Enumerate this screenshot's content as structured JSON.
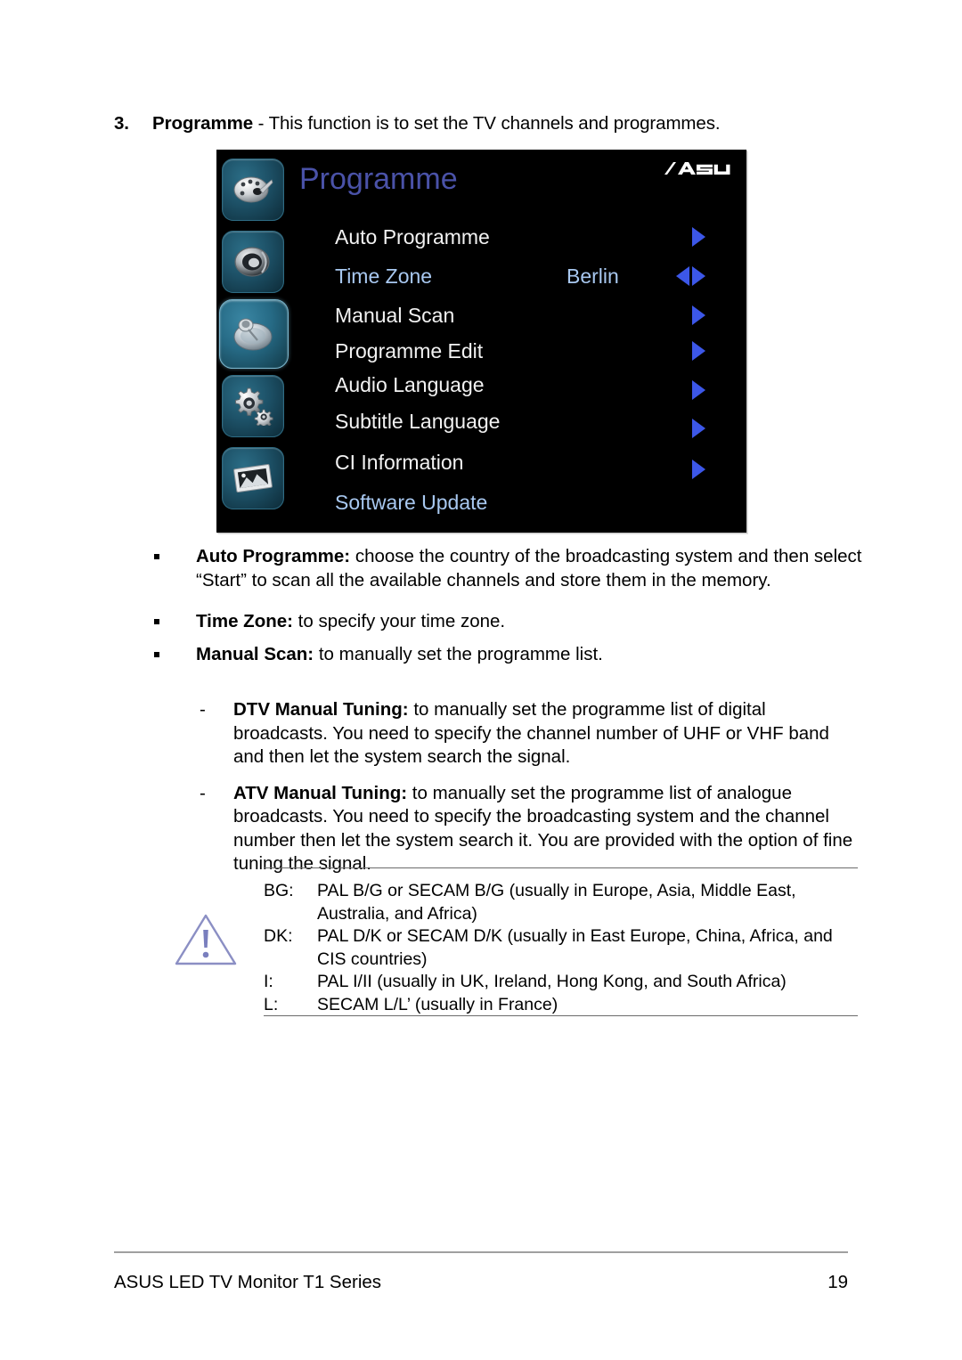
{
  "step": {
    "number": "3.",
    "title": "Programme",
    "description": " - This function is to set the TV channels and programmes."
  },
  "osd": {
    "title": "Programme",
    "brand": "ASUS",
    "sidebar_icons": [
      {
        "name": "palette-icon",
        "label": "Picture"
      },
      {
        "name": "speaker-icon",
        "label": "Sound"
      },
      {
        "name": "satellite-dish-icon",
        "label": "Programme"
      },
      {
        "name": "gears-icon",
        "label": "Setup"
      },
      {
        "name": "photo-icon",
        "label": "Image"
      }
    ],
    "selected_icon_index": 2,
    "colors": {
      "title": "#4a52a8",
      "label": "#f2f2f2",
      "highlight": "#a8c8f0",
      "arrow": "#3c57e8",
      "background": "#000000"
    },
    "rows": [
      {
        "label": "Auto Programme",
        "value": "",
        "arrows": "right",
        "highlighted": false
      },
      {
        "label": "Time Zone",
        "value": "Berlin",
        "arrows": "both",
        "highlighted": true
      },
      {
        "label": "Manual Scan",
        "value": "",
        "arrows": "right",
        "highlighted": false
      },
      {
        "label": "Programme Edit",
        "value": "",
        "arrows": "right",
        "highlighted": false
      },
      {
        "label": "Audio Language",
        "value": "",
        "arrows": "right",
        "highlighted": false
      },
      {
        "label": "Subtitle Language",
        "value": "",
        "arrows": "right",
        "highlighted": false
      },
      {
        "label": "CI Information",
        "value": "",
        "arrows": "right",
        "highlighted": false
      },
      {
        "label": "Software Update",
        "value": "",
        "arrows": "none",
        "highlighted": true
      }
    ]
  },
  "bullets": [
    {
      "term": "Auto Programme:",
      "text": " choose the country of the broadcasting system and then select “Start” to scan all the available channels and store them in the memory."
    },
    {
      "term": "Time Zone:",
      "text": " to specify your time zone."
    },
    {
      "term": "Manual Scan:",
      "text": " to manually set the programme list."
    }
  ],
  "sub_items": [
    {
      "marker": "-",
      "term": "DTV Manual Tuning:",
      "text": " to manually set the programme list of digital broadcasts. You need to specify the channel number of UHF or VHF band and then let the system search the signal."
    },
    {
      "marker": "-",
      "term": "ATV Manual Tuning:",
      "text": " to manually set the programme list of analogue broadcasts. You need to specify the broadcasting system and the channel number then let the system search it. You are provided with the option of fine tuning the signal."
    }
  ],
  "note": {
    "icon": "warning-triangle-icon",
    "rows": [
      {
        "key": "BG:",
        "text": "PAL B/G or SECAM B/G (usually in Europe, Asia, Middle East, Australia, and Africa)"
      },
      {
        "key": "DK:",
        "text": "PAL D/K or SECAM D/K (usually in East Europe, China, Africa, and CIS countries)"
      },
      {
        "key": "I:",
        "text": "PAL I/II (usually in UK, Ireland, Hong Kong, and South Africa)"
      },
      {
        "key": "L:",
        "text": "SECAM L/L’ (usually in France)"
      }
    ]
  },
  "footer": {
    "left": "ASUS LED TV Monitor T1 Series",
    "page": "19"
  }
}
